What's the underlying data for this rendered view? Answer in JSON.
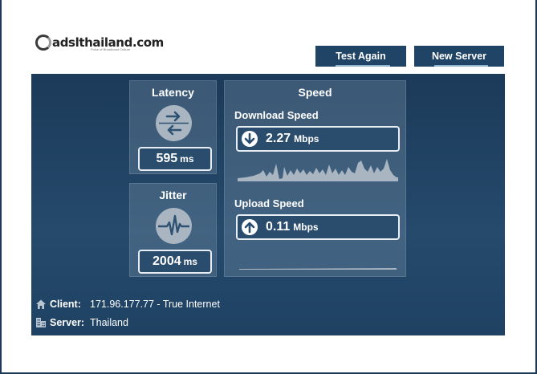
{
  "header": {
    "logo_text": "adslthailand.com",
    "logo_tagline": "Pulse of Broadband Culture",
    "test_again_label": "Test Again",
    "new_server_label": "New Server"
  },
  "latency": {
    "title": "Latency",
    "value": "595",
    "unit": "ms"
  },
  "jitter": {
    "title": "Jitter",
    "value": "2004",
    "unit": "ms"
  },
  "speed": {
    "title": "Speed",
    "download": {
      "label": "Download Speed",
      "value": "2.27",
      "unit": "Mbps"
    },
    "upload": {
      "label": "Upload Speed",
      "value": "0.11",
      "unit": "Mbps"
    }
  },
  "info": {
    "client_label": "Client:",
    "client_value": "171.96.177.77 - True Internet",
    "server_label": "Server:",
    "server_value": "Thailand"
  },
  "colors": {
    "panel": "#1f4263",
    "button": "#1f4465",
    "accent": "#8fb3cf"
  }
}
